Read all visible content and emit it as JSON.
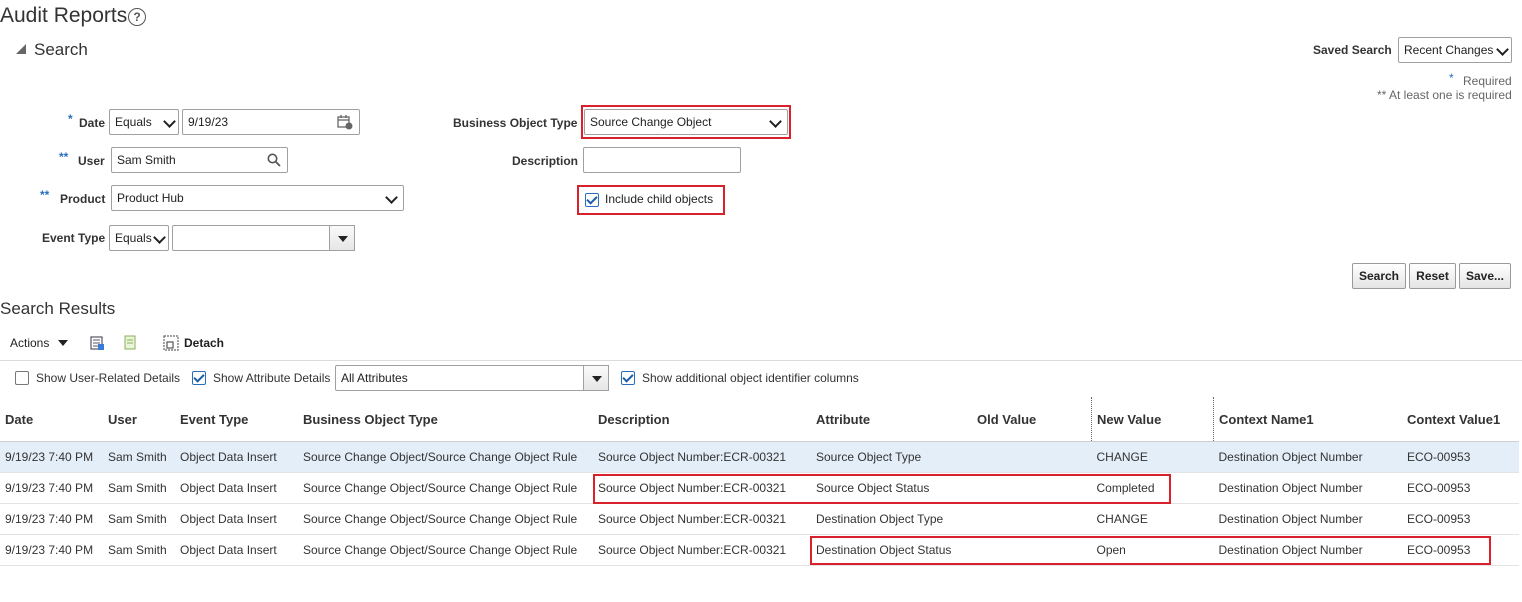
{
  "page": {
    "title": "Audit Reports",
    "help_icon": "help-icon"
  },
  "search": {
    "header": "Search",
    "saved_search_label": "Saved Search",
    "saved_search_value": "Recent Changes",
    "required_note": "Required",
    "required_star": "*",
    "at_least_one_note": "** At least one is required",
    "date": {
      "label": "Date",
      "marker": "*",
      "operator": "Equals",
      "value": "9/19/23"
    },
    "user": {
      "label": "User",
      "marker": "**",
      "value": "Sam Smith"
    },
    "product": {
      "label": "Product",
      "marker": "**",
      "value": "Product Hub"
    },
    "event_type": {
      "label": "Event Type",
      "operator": "Equals",
      "value": ""
    },
    "business_object_type": {
      "label": "Business Object Type",
      "value": "Source Change Object"
    },
    "description": {
      "label": "Description",
      "value": ""
    },
    "include_child_objects": {
      "label": "Include child objects",
      "checked": true
    },
    "buttons": {
      "search": "Search",
      "reset": "Reset",
      "save": "Save..."
    }
  },
  "results": {
    "title": "Search Results",
    "toolbar": {
      "actions": "Actions",
      "detach": "Detach"
    },
    "options": {
      "show_user_related": "Show User-Related Details",
      "show_attribute_details": "Show Attribute Details",
      "attributes_value": "All Attributes",
      "show_additional_ids": "Show additional object identifier columns"
    },
    "columns": [
      "Date",
      "User",
      "Event Type",
      "Business Object Type",
      "Description",
      "Attribute",
      "Old Value",
      "New Value",
      "Context Name1",
      "Context Value1"
    ],
    "rows": [
      [
        "9/19/23 7:40 PM",
        "Sam Smith",
        "Object Data Insert",
        "Source Change Object/Source Change Object Rule",
        "Source Object Number:ECR-00321",
        "Source Object Type",
        "",
        "CHANGE",
        "Destination Object Number",
        "ECO-00953"
      ],
      [
        "9/19/23 7:40 PM",
        "Sam Smith",
        "Object Data Insert",
        "Source Change Object/Source Change Object Rule",
        "Source Object Number:ECR-00321",
        "Source Object Status",
        "",
        "Completed",
        "Destination Object Number",
        "ECO-00953"
      ],
      [
        "9/19/23 7:40 PM",
        "Sam Smith",
        "Object Data Insert",
        "Source Change Object/Source Change Object Rule",
        "Source Object Number:ECR-00321",
        "Destination Object Type",
        "",
        "CHANGE",
        "Destination Object Number",
        "ECO-00953"
      ],
      [
        "9/19/23 7:40 PM",
        "Sam Smith",
        "Object Data Insert",
        "Source Change Object/Source Change Object Rule",
        "Source Object Number:ECR-00321",
        "Destination Object Status",
        "",
        "Open",
        "Destination Object Number",
        "ECO-00953"
      ]
    ]
  },
  "colors": {
    "highlight": "#d9212c",
    "accent": "#2a6ebb",
    "selected_row": "#e4eef8"
  }
}
